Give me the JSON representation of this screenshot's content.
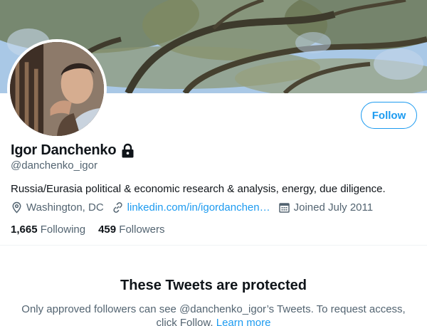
{
  "profile": {
    "display_name": "Igor Danchenko",
    "handle": "@danchenko_igor",
    "bio": "Russia/Eurasia political & economic research & analysis, energy, due diligence.",
    "location": "Washington, DC",
    "website": "linkedin.com/in/igordanchen…",
    "joined": "Joined July 2011",
    "protected": true
  },
  "actions": {
    "follow_label": "Follow"
  },
  "stats": {
    "following_count": "1,665",
    "following_label": "Following",
    "followers_count": "459",
    "followers_label": "Followers"
  },
  "protected_notice": {
    "title": "These Tweets are protected",
    "body": "Only approved followers can see @danchenko_igor’s Tweets. To request access, click Follow.",
    "link": "Learn more"
  },
  "colors": {
    "accent": "#1d9bf0",
    "text_primary": "#0f1419",
    "text_secondary": "#536471"
  },
  "icons": [
    "lock-icon",
    "location-icon",
    "link-icon",
    "calendar-icon"
  ]
}
